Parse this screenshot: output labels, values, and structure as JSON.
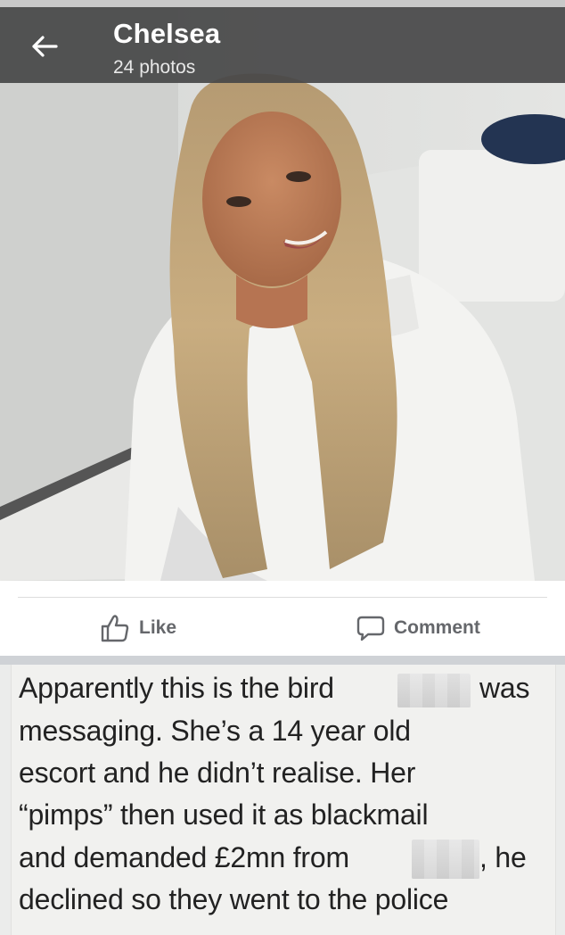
{
  "header": {
    "title": "Chelsea",
    "photo_count": "24 photos"
  },
  "actions": {
    "like_label": "Like",
    "comment_label": "Comment"
  },
  "post_text": {
    "line1_start": "Apparently this is the bird",
    "line1_end": "was",
    "line2": "messaging. She’s a 14 year old",
    "line3": "escort and he didn’t realise. Her",
    "line4": "“pimps” then used it as blackmail",
    "line5_start": "and demanded £2mn from",
    "line5_end": ", he",
    "line6": "declined so they went to the police"
  },
  "colors": {
    "header_overlay": "#464648",
    "action_text": "#65676b",
    "card_background": "#f1f1ef"
  }
}
